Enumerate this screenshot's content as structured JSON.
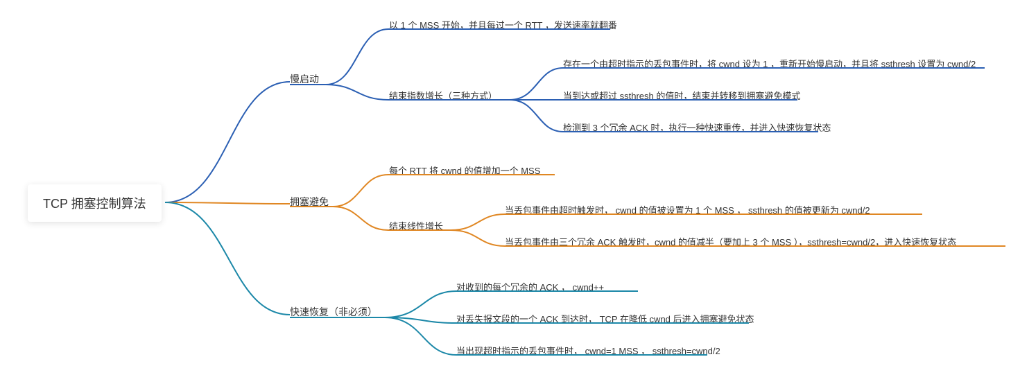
{
  "root": {
    "label": "TCP 拥塞控制算法"
  },
  "colors": {
    "blue": "#2b5fb3",
    "orange": "#e08723",
    "teal": "#1c88a8"
  },
  "branches": [
    {
      "id": "slowstart",
      "label": "慢启动",
      "children": [
        {
          "id": "ss_1",
          "label": "以 1 个 MSS 开始，并且每过一个 RTT ，发送速率就翻番"
        },
        {
          "id": "ss_end",
          "label": "结束指数增长（三种方式）",
          "children": [
            {
              "id": "ss_end_1",
              "label": "存在一个由超时指示的丢包事件时，将 cwnd 设为 1 ，重新开始慢启动，并且将 ssthresh 设置为 cwnd/2"
            },
            {
              "id": "ss_end_2",
              "label": "当到达或超过 ssthresh 的值时，结束并转移到拥塞避免模式"
            },
            {
              "id": "ss_end_3",
              "label": "检测到 3 个冗余 ACK 时，执行一种快速重传，并进入快速恢复状态"
            }
          ]
        }
      ]
    },
    {
      "id": "avoid",
      "label": "拥塞避免",
      "children": [
        {
          "id": "av_1",
          "label": "每个 RTT 将 cwnd 的值增加一个 MSS"
        },
        {
          "id": "av_end",
          "label": "结束线性增长",
          "children": [
            {
              "id": "av_end_1",
              "label": "当丢包事件由超时触发时， cwnd 的值被设置为 1 个 MSS ， ssthresh 的值被更新为 cwnd/2"
            },
            {
              "id": "av_end_2",
              "label": "当丢包事件由三个冗余 ACK 触发时，cwnd 的值减半（要加上 3 个 MSS ），ssthresh=cwnd/2，进入快速恢复状态"
            }
          ]
        }
      ]
    },
    {
      "id": "recover",
      "label": "快速恢复（非必须）",
      "children": [
        {
          "id": "rc_1",
          "label": "对收到的每个冗余的 ACK ， cwnd++"
        },
        {
          "id": "rc_2",
          "label": "对丢失报文段的一个 ACK 到达时， TCP 在降低 cwnd 后进入拥塞避免状态"
        },
        {
          "id": "rc_3",
          "label": "当出现超时指示的丢包事件时， cwnd=1 MSS ， ssthresh=cwnd/2"
        }
      ]
    }
  ]
}
